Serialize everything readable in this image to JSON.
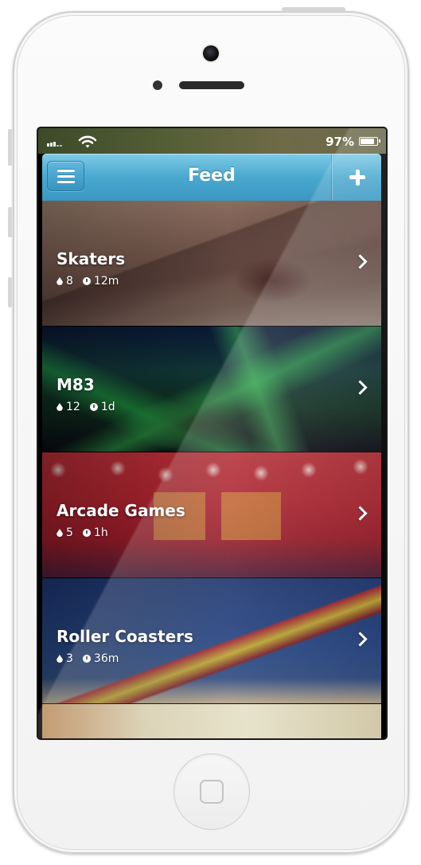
{
  "status_bar": {
    "battery_percent": "97%",
    "battery_level": 0.97,
    "signal_icon": "signal-bars-icon",
    "wifi_icon": "wifi-icon"
  },
  "nav": {
    "title": "Feed",
    "menu_icon": "hamburger-menu-icon",
    "add_icon": "plus-icon",
    "accent_color": "#4aa8cf"
  },
  "feed": {
    "items": [
      {
        "title": "Skaters",
        "drops": "8",
        "time": "12m"
      },
      {
        "title": "M83",
        "drops": "12",
        "time": "1d"
      },
      {
        "title": "Arcade Games",
        "drops": "5",
        "time": "1h"
      },
      {
        "title": "Roller Coasters",
        "drops": "3",
        "time": "36m"
      }
    ]
  }
}
